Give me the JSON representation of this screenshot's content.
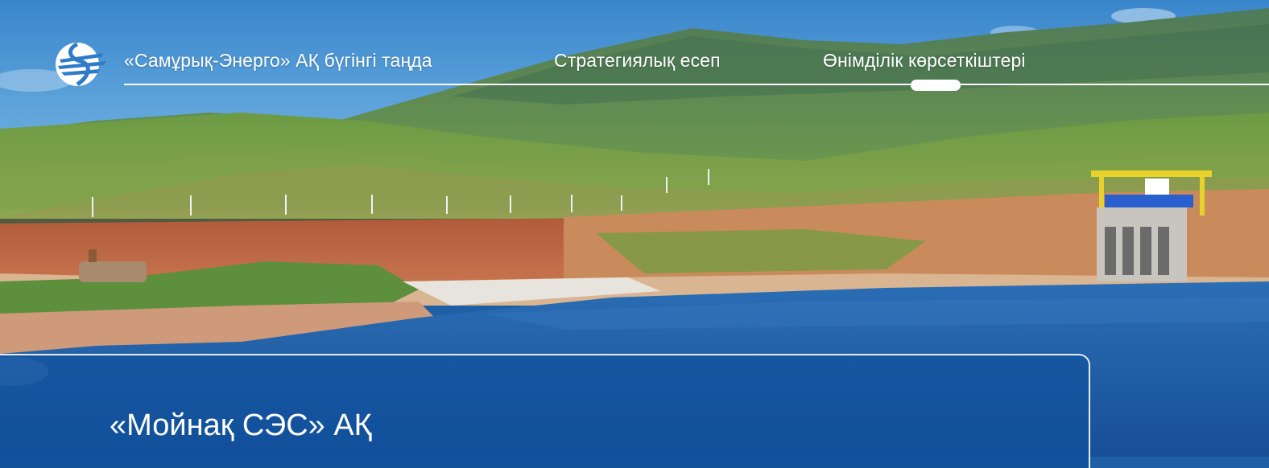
{
  "nav": {
    "items": [
      {
        "label": "«Самұрық-Энерго» АҚ бүгінгі таңда"
      },
      {
        "label": "Стратегиялық есеп"
      },
      {
        "label": "Өнімділік көрсеткіштері"
      }
    ],
    "active_index": 2
  },
  "hero": {
    "title": "«Мойнақ СЭС» АҚ"
  },
  "logo": {
    "icon": "samruk-energy-logo-icon"
  },
  "colors": {
    "sky": "#3f8fd0",
    "water": "#1f5fa6",
    "panel": "#1454a0",
    "text": "#ffffff"
  }
}
